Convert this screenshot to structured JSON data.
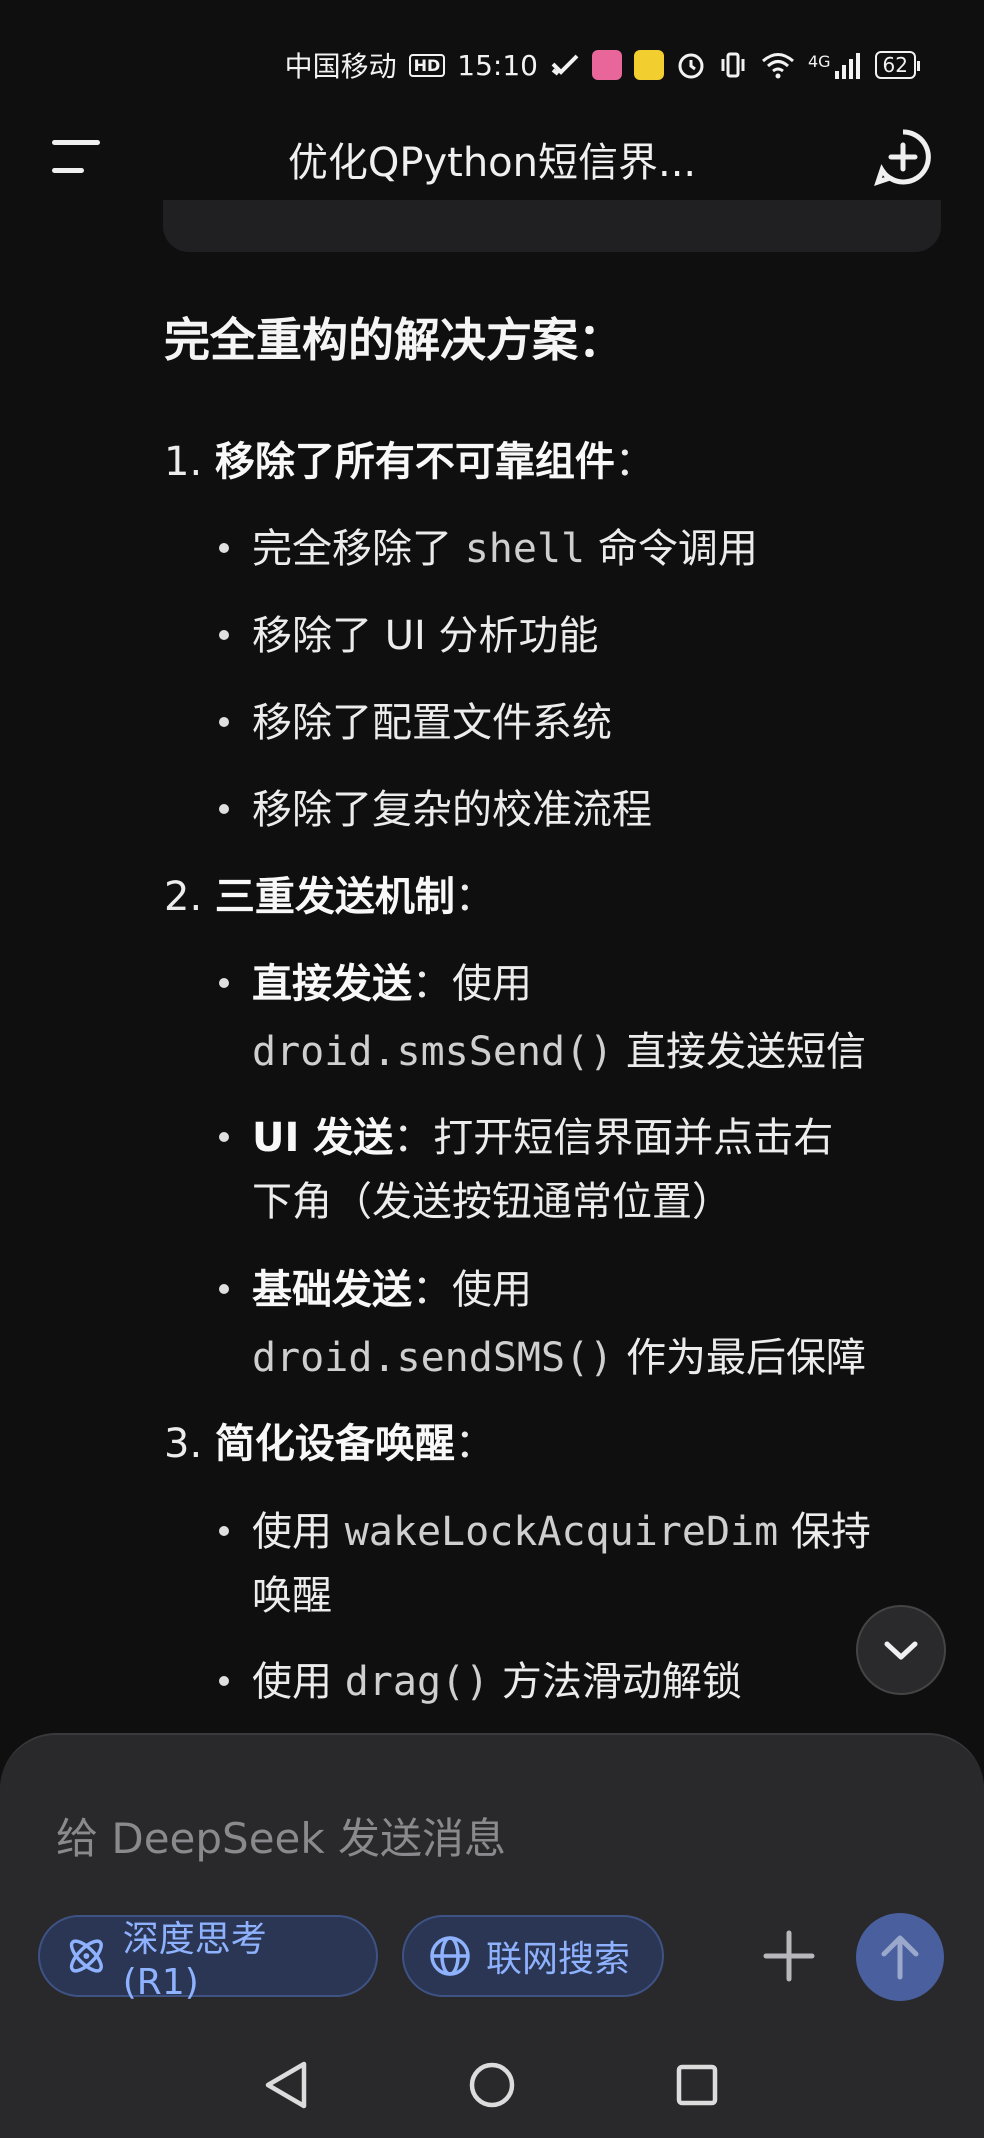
{
  "status_bar": {
    "carrier": "中国移动",
    "hd": "HD",
    "time": "15:10",
    "network": "4G",
    "battery": "62"
  },
  "header": {
    "title": "优化QPython短信界..."
  },
  "content": {
    "heading": "完全重构的解决方案：",
    "sections": [
      {
        "number": "1.",
        "title": "移除了所有不可靠组件",
        "colon": "：",
        "items": [
          {
            "pre": "完全移除了 ",
            "code": "shell",
            "post": " 命令调用"
          },
          {
            "text": "移除了 UI 分析功能"
          },
          {
            "text": "移除了配置文件系统"
          },
          {
            "text": "移除了复杂的校准流程"
          }
        ]
      },
      {
        "number": "2.",
        "title": "三重发送机制",
        "colon": "：",
        "items": [
          {
            "bold": "直接发送",
            "line1": "：使用",
            "code": "droid.smsSend()",
            "post": " 直接发送短信"
          },
          {
            "bold": "UI 发送",
            "line1": "：打开短信界面并点击右",
            "line2": "下角（发送按钮通常位置）"
          },
          {
            "bold": "基础发送",
            "line1": "：使用",
            "code": "droid.sendSMS()",
            "post": " 作为最后保障"
          }
        ]
      },
      {
        "number": "3.",
        "title": "简化设备唤醒",
        "colon": "：",
        "items": [
          {
            "pre": "使用 ",
            "code": "wakeLockAcquireDim",
            "post": " 保持",
            "line2": "唤醒"
          },
          {
            "pre": "使用 ",
            "code": "drag()",
            "post": " 方法滑动解锁"
          }
        ]
      }
    ]
  },
  "composer": {
    "placeholder": "给 DeepSeek 发送消息",
    "deep_think_label": "深度思考 (R1)",
    "web_search_label": "联网搜索"
  },
  "colors": {
    "background": "#0f0f10",
    "chip_text": "#8fb2ff",
    "send_button": "#4a5f9e"
  }
}
